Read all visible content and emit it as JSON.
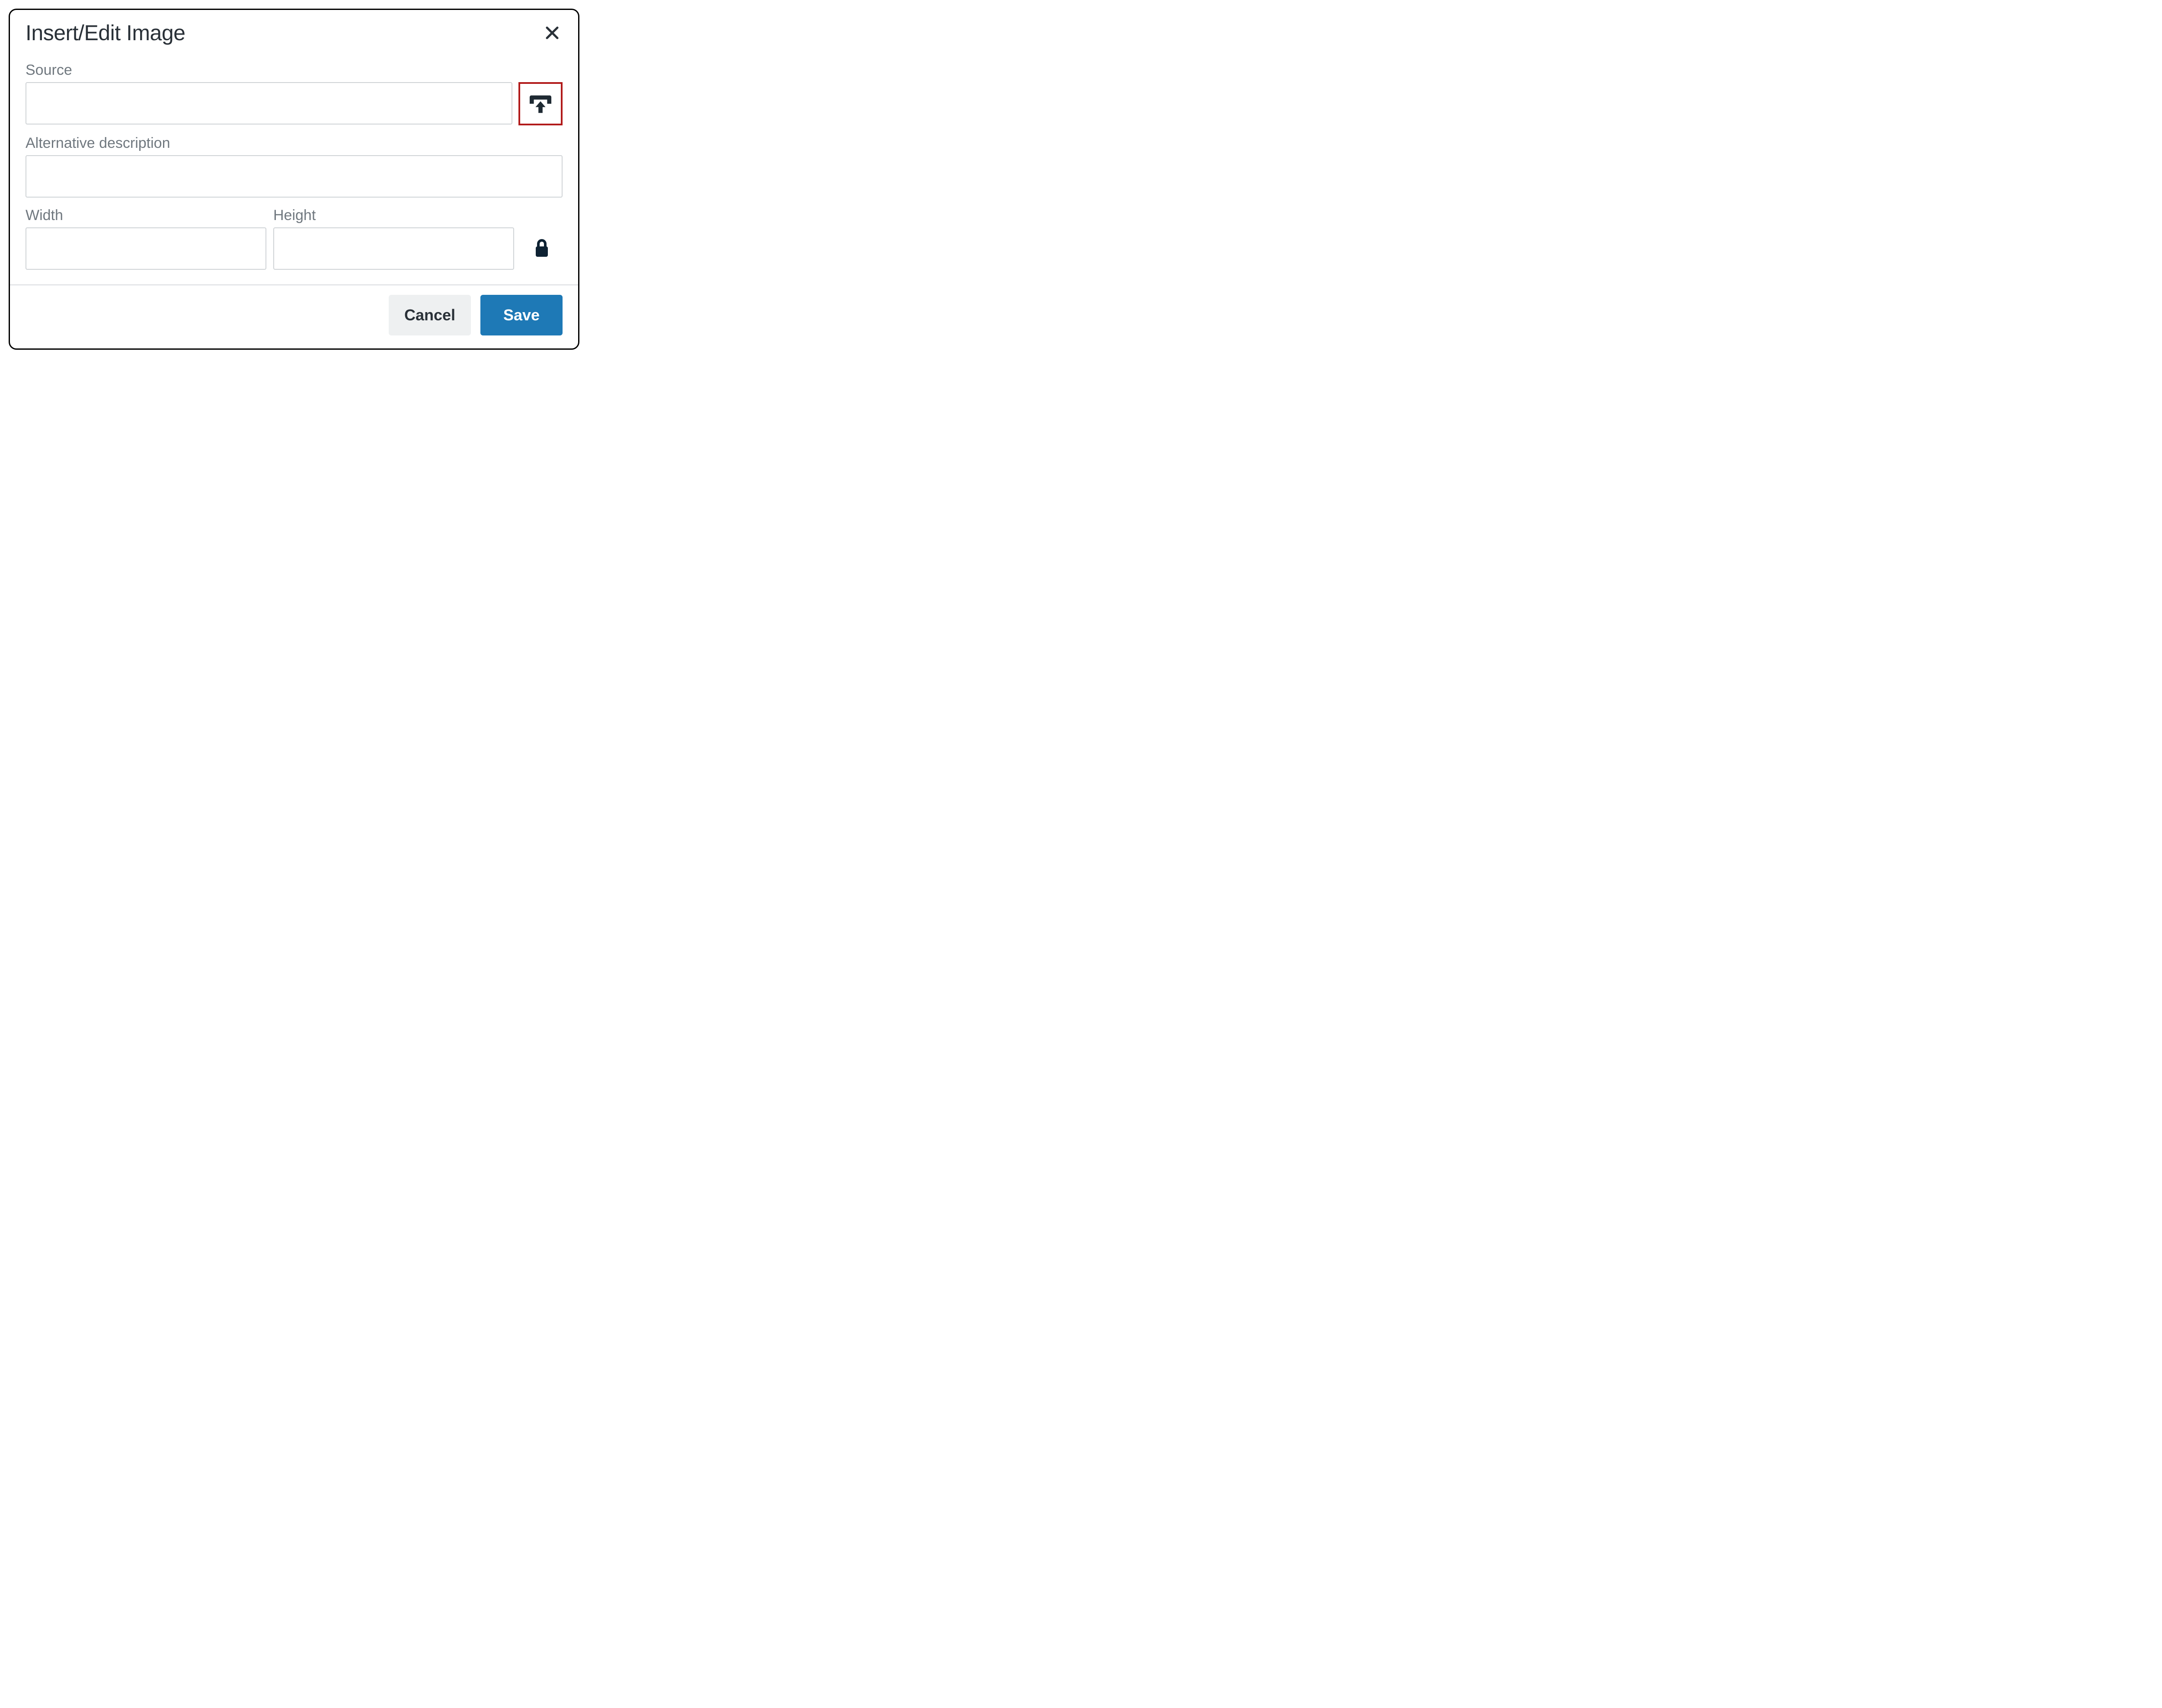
{
  "dialog": {
    "title": "Insert/Edit Image",
    "fields": {
      "source": {
        "label": "Source",
        "value": ""
      },
      "alt": {
        "label": "Alternative description",
        "value": ""
      },
      "width": {
        "label": "Width",
        "value": ""
      },
      "height": {
        "label": "Height",
        "value": ""
      }
    },
    "buttons": {
      "cancel": "Cancel",
      "save": "Save"
    },
    "icons": {
      "close": "close-icon",
      "upload": "upload-icon",
      "lock": "lock-icon"
    }
  }
}
